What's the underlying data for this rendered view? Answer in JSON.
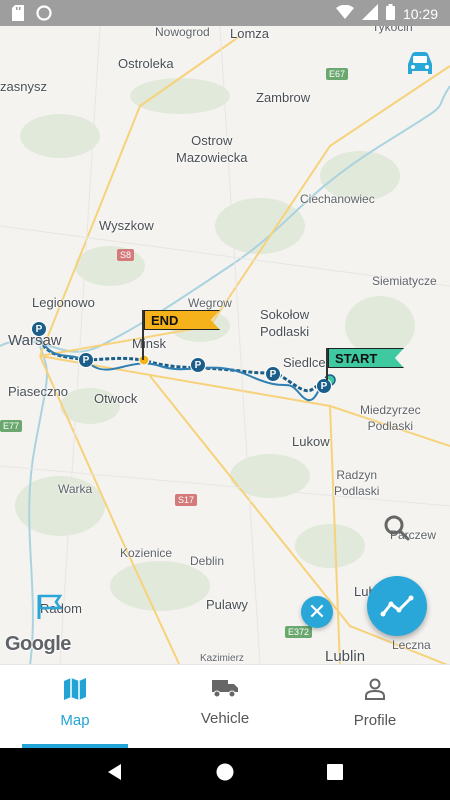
{
  "status_bar": {
    "time": "10:29",
    "icons": [
      "sd-card-icon",
      "circle-notification-icon",
      "wifi-icon",
      "signal-icon",
      "battery-icon"
    ]
  },
  "map": {
    "towns": [
      {
        "name": "Nowogrod"
      },
      {
        "name": "Lomza"
      },
      {
        "name": "Tykocin"
      },
      {
        "name": "Ostroleka"
      },
      {
        "name": "zasnysz"
      },
      {
        "name": "Zambrow"
      },
      {
        "name": "Ostrow\nMazowiecka"
      },
      {
        "name": "Ciechanowiec"
      },
      {
        "name": "Wyszkow"
      },
      {
        "name": "Siemiatycze"
      },
      {
        "name": "Legionowo"
      },
      {
        "name": "Wegrow"
      },
      {
        "name": "Sokołow\nPodlaski"
      },
      {
        "name": "Warsaw"
      },
      {
        "name": "Minsk"
      },
      {
        "name": "Siedlce"
      },
      {
        "name": "Piaseczno"
      },
      {
        "name": "Otwock"
      },
      {
        "name": "Miedzyrzec\nPodlaski"
      },
      {
        "name": "Lukow"
      },
      {
        "name": "Radzyn\nPodlaski"
      },
      {
        "name": "Warka"
      },
      {
        "name": "Parczew"
      },
      {
        "name": "Kozienice"
      },
      {
        "name": "Deblin"
      },
      {
        "name": "Lubart"
      },
      {
        "name": "Radom"
      },
      {
        "name": "Pulawy"
      },
      {
        "name": "Lublin"
      },
      {
        "name": "Leczna"
      },
      {
        "name": "Kazimierz"
      }
    ],
    "road_labels": [
      "E67",
      "S8",
      "S17",
      "E77",
      "E372"
    ],
    "end_flag": "END",
    "start_flag": "START",
    "parking_marker": "P",
    "google_logo": "Google",
    "accent_color": "#29a7d8",
    "route_color": "#1b5e8a"
  },
  "nav": {
    "items": [
      {
        "label": "Map",
        "icon": "map-icon",
        "active": true
      },
      {
        "label": "Vehicle",
        "icon": "truck-icon",
        "active": false
      },
      {
        "label": "Profile",
        "icon": "person-icon",
        "active": false
      }
    ]
  }
}
